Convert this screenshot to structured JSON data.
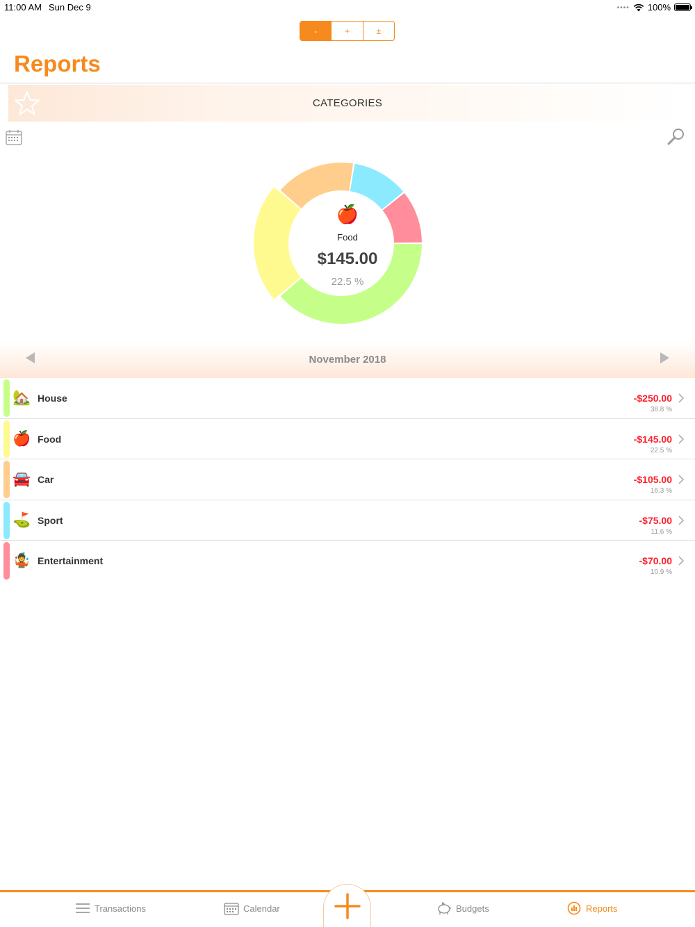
{
  "status_bar": {
    "time": "11:00 AM",
    "date": "Sun Dec 9",
    "battery": "100%"
  },
  "segmented": [
    {
      "label": "-",
      "active": true
    },
    {
      "label": "+",
      "active": false
    },
    {
      "label": "±",
      "active": false
    }
  ],
  "page_title": "Reports",
  "banner": {
    "label": "CATEGORIES"
  },
  "selected": {
    "emoji": "🍎",
    "name": "Food",
    "amount": "$145.00",
    "percent": "22.5 %"
  },
  "month": "November 2018",
  "chart_data": {
    "type": "pie",
    "categories": [
      "House",
      "Food",
      "Car",
      "Sport",
      "Entertainment"
    ],
    "values": [
      250,
      145,
      105,
      75,
      70
    ],
    "colors": [
      "#c5ff8a",
      "#fffa90",
      "#ffcd8c",
      "#8ceaff",
      "#ff8d9c"
    ],
    "selected_category": "Food"
  },
  "categories": [
    {
      "name": "House",
      "emoji": "🏡",
      "amount": "-$250.00",
      "percent": "38.8 %",
      "color": "#c5ff8a"
    },
    {
      "name": "Food",
      "emoji": "🍎",
      "amount": "-$145.00",
      "percent": "22.5 %",
      "color": "#fffa90"
    },
    {
      "name": "Car",
      "emoji": "🚘",
      "amount": "-$105.00",
      "percent": "16.3 %",
      "color": "#ffcd8c"
    },
    {
      "name": "Sport",
      "emoji": "⛳",
      "amount": "-$75.00",
      "percent": "11.6 %",
      "color": "#8ceaff"
    },
    {
      "name": "Entertainment",
      "emoji": "🤹",
      "amount": "-$70.00",
      "percent": "10.9 %",
      "color": "#ff8d9c"
    }
  ],
  "tabs": {
    "transactions": "Transactions",
    "calendar": "Calendar",
    "budgets": "Budgets",
    "reports": "Reports"
  },
  "accent_color": "#f68a1e"
}
